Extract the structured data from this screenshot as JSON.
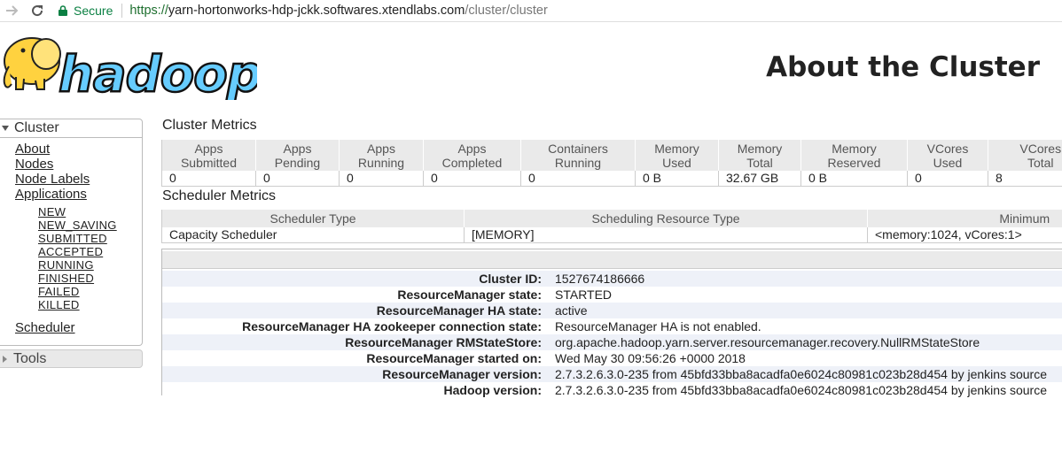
{
  "browser": {
    "secure_label": "Secure",
    "url_scheme": "https://",
    "url_host": "yarn-hortonworks-hdp-jckk.softwares.xtendlabs.com",
    "url_path": "/cluster/cluster"
  },
  "header": {
    "logo_text": "hadoop",
    "title": "About the Cluster"
  },
  "nav": {
    "cluster_label": "Cluster",
    "items": [
      "About",
      "Nodes",
      "Node Labels",
      "Applications"
    ],
    "app_states": [
      "NEW",
      "NEW_SAVING",
      "SUBMITTED",
      "ACCEPTED",
      "RUNNING",
      "FINISHED",
      "FAILED",
      "KILLED"
    ],
    "scheduler": "Scheduler",
    "tools_label": "Tools"
  },
  "cluster_metrics": {
    "title": "Cluster Metrics",
    "headers": [
      [
        "Apps",
        "Submitted"
      ],
      [
        "Apps",
        "Pending"
      ],
      [
        "Apps",
        "Running"
      ],
      [
        "Apps",
        "Completed"
      ],
      [
        "Containers",
        "Running"
      ],
      [
        "Memory",
        "Used"
      ],
      [
        "Memory",
        "Total"
      ],
      [
        "Memory",
        "Reserved"
      ],
      [
        "VCores",
        "Used"
      ],
      [
        "VCores",
        "Total"
      ]
    ],
    "values": [
      "0",
      "0",
      "0",
      "0",
      "0",
      "0 B",
      "32.67 GB",
      "0 B",
      "0",
      "8"
    ]
  },
  "scheduler_metrics": {
    "title": "Scheduler Metrics",
    "headers": [
      "Scheduler Type",
      "Scheduling Resource Type",
      "Minimum"
    ],
    "values": [
      "Capacity Scheduler",
      "[MEMORY]",
      "<memory:1024, vCores:1>"
    ]
  },
  "cluster_info": [
    {
      "label": "Cluster ID:",
      "value": "1527674186666"
    },
    {
      "label": "ResourceManager state:",
      "value": "STARTED"
    },
    {
      "label": "ResourceManager HA state:",
      "value": "active"
    },
    {
      "label": "ResourceManager HA zookeeper connection state:",
      "value": "ResourceManager HA is not enabled."
    },
    {
      "label": "ResourceManager RMStateStore:",
      "value": "org.apache.hadoop.yarn.server.resourcemanager.recovery.NullRMStateStore"
    },
    {
      "label": "ResourceManager started on:",
      "value": "Wed May 30 09:56:26 +0000 2018"
    },
    {
      "label": "ResourceManager version:",
      "value": "2.7.3.2.6.3.0-235 from 45bfd33bba8acadfa0e6024c80981c023b28d454 by jenkins source"
    },
    {
      "label": "Hadoop version:",
      "value": "2.7.3.2.6.3.0-235 from 45bfd33bba8acadfa0e6024c80981c023b28d454 by jenkins source"
    }
  ],
  "colors": {
    "secure_green": "#0b8043",
    "logo_blue": "#66ccff",
    "elephant_yellow": "#ffd23f"
  }
}
